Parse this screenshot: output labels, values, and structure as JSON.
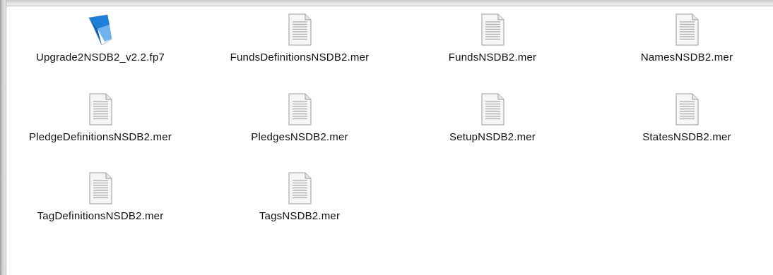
{
  "files": [
    {
      "name": "Upgrade2NSDB2_v2.2.fp7",
      "icon": "filemaker-database-icon"
    },
    {
      "name": "FundsDefinitionsNSDB2.mer",
      "icon": "document-icon"
    },
    {
      "name": "FundsNSDB2.mer",
      "icon": "document-icon"
    },
    {
      "name": "NamesNSDB2.mer",
      "icon": "document-icon"
    },
    {
      "name": "PledgeDefinitionsNSDB2.mer",
      "icon": "document-icon"
    },
    {
      "name": "PledgesNSDB2.mer",
      "icon": "document-icon"
    },
    {
      "name": "SetupNSDB2.mer",
      "icon": "document-icon"
    },
    {
      "name": "StatesNSDB2.mer",
      "icon": "document-icon"
    },
    {
      "name": "TagDefinitionsNSDB2.mer",
      "icon": "document-icon"
    },
    {
      "name": "TagsNSDB2.mer",
      "icon": "document-icon"
    }
  ],
  "colors": {
    "filemaker_blue": "#1f7fd8",
    "document_fill": "#f4f4f4",
    "document_lines": "#a8a8a8"
  }
}
